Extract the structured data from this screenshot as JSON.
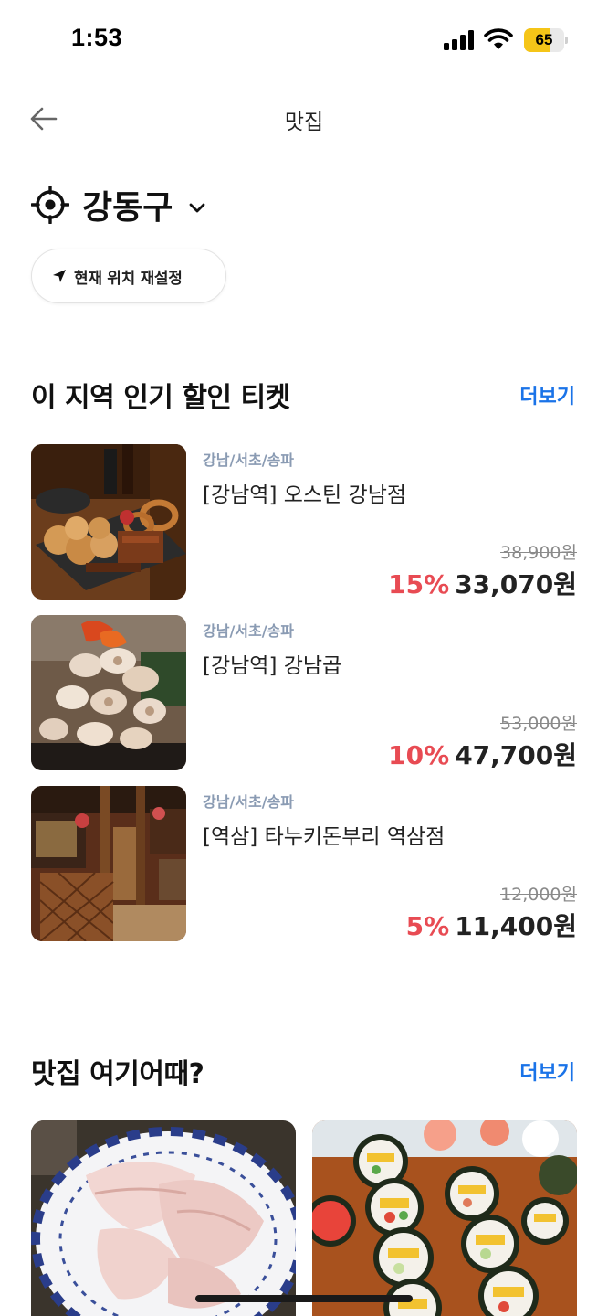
{
  "status_bar": {
    "time": "1:53",
    "battery_level": "65",
    "battery_fraction": 0.65,
    "icons": [
      "signal-icon",
      "wifi-icon",
      "battery-icon"
    ]
  },
  "header": {
    "title": "맛집",
    "back_icon": "arrow-left-icon"
  },
  "location": {
    "name": "강동구",
    "icon": "crosshair-icon",
    "dropdown_icon": "chevron-down-icon",
    "reset_label": "현재 위치 재설정",
    "reset_icon": "navigation-arrow-icon"
  },
  "popular_section": {
    "title": "이 지역 인기 할인 티켓",
    "more_label": "더보기",
    "items": [
      {
        "region": "강남/서초/송파",
        "name": "[강남역] 오스틴 강남점",
        "original_price": "38,900원",
        "discount": "15%",
        "price": "33,070원",
        "image": "burger-platter-photo"
      },
      {
        "region": "강남/서초/송파",
        "name": "[강남역] 강남곱",
        "original_price": "53,000원",
        "discount": "10%",
        "price": "47,700원",
        "image": "grilled-intestines-photo"
      },
      {
        "region": "강남/서초/송파",
        "name": "[역삼] 타누키돈부리 역삼점",
        "original_price": "12,000원",
        "discount": "5%",
        "price": "11,400원",
        "image": "izakaya-interior-photo"
      }
    ]
  },
  "recommend_section": {
    "title": "맛집 여기어때?",
    "more_label": "더보기",
    "cards": [
      {
        "image": "sashimi-plate-photo"
      },
      {
        "image": "kimbap-sushi-photo"
      }
    ]
  },
  "colors": {
    "accent_blue": "#1a73e8",
    "discount_red": "#e84b53",
    "region_gray": "#8a9bb3",
    "battery_yellow": "#f5c518"
  }
}
